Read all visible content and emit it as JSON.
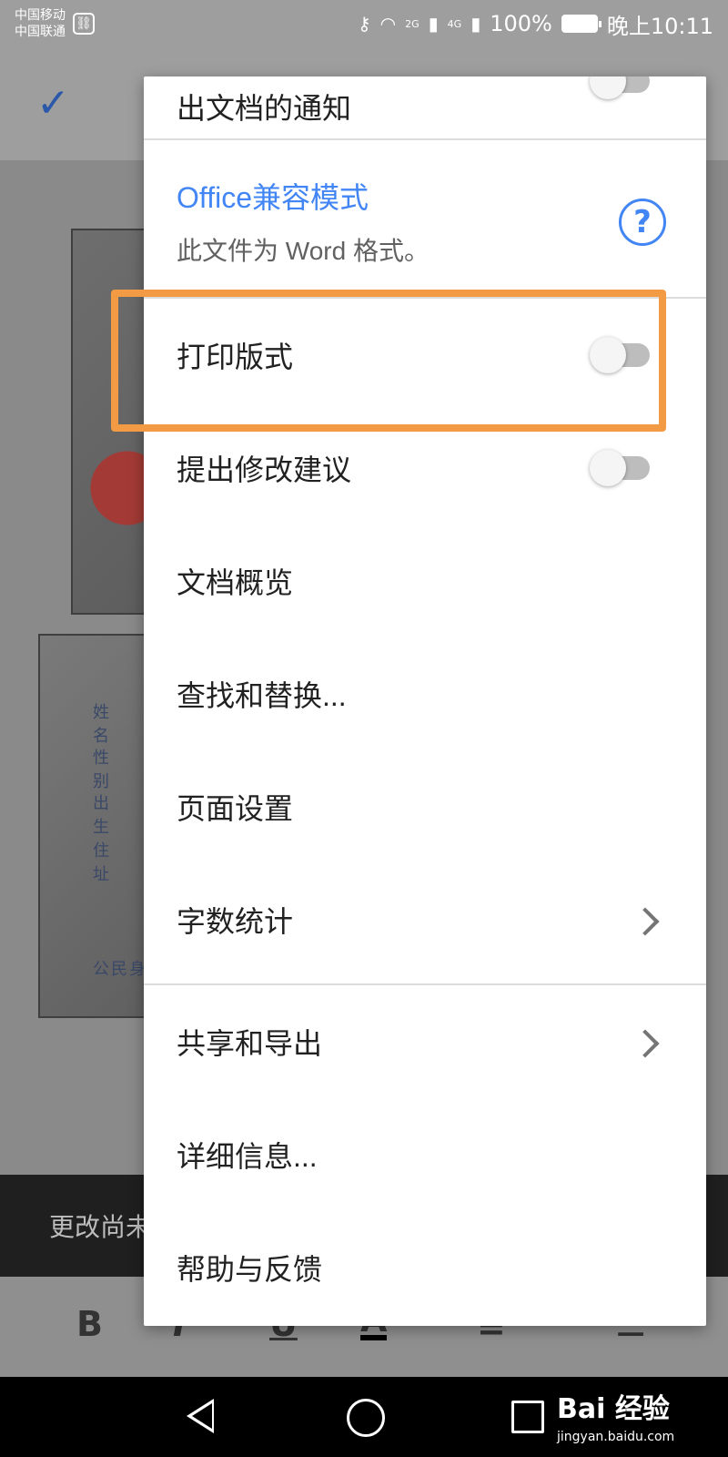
{
  "status_bar": {
    "carrier_1": "中国移动",
    "carrier_2": "中国联通",
    "signal_1_label": "2G",
    "signal_2_label": "4G",
    "battery": "100%",
    "time": "晚上10:11"
  },
  "snackbar": {
    "text": "更改尚未"
  },
  "menu": {
    "notify_toggle_label": "出文档的通知",
    "notify_toggle_on": false,
    "office_mode": {
      "title": "Office兼容模式",
      "subtitle": "此文件为 Word 格式。"
    },
    "items": [
      {
        "label": "打印版式",
        "toggle_on": false
      },
      {
        "label": "提出修改建议",
        "toggle_on": false
      },
      {
        "label": "文档概览"
      },
      {
        "label": "查找和替换..."
      },
      {
        "label": "页面设置"
      },
      {
        "label": "字数统计"
      },
      {
        "label": "共享和导出"
      },
      {
        "label": "详细信息..."
      },
      {
        "label": "帮助与反馈"
      }
    ]
  },
  "document": {
    "id_card_fields": [
      "姓 名",
      "性 别",
      "出 生",
      "住 址",
      "公民身"
    ]
  },
  "watermark": {
    "brand": "Bai 经验",
    "url": "jingyan.baidu.com"
  },
  "colors": {
    "highlight": "#f39a45",
    "accent": "#4285f4"
  }
}
